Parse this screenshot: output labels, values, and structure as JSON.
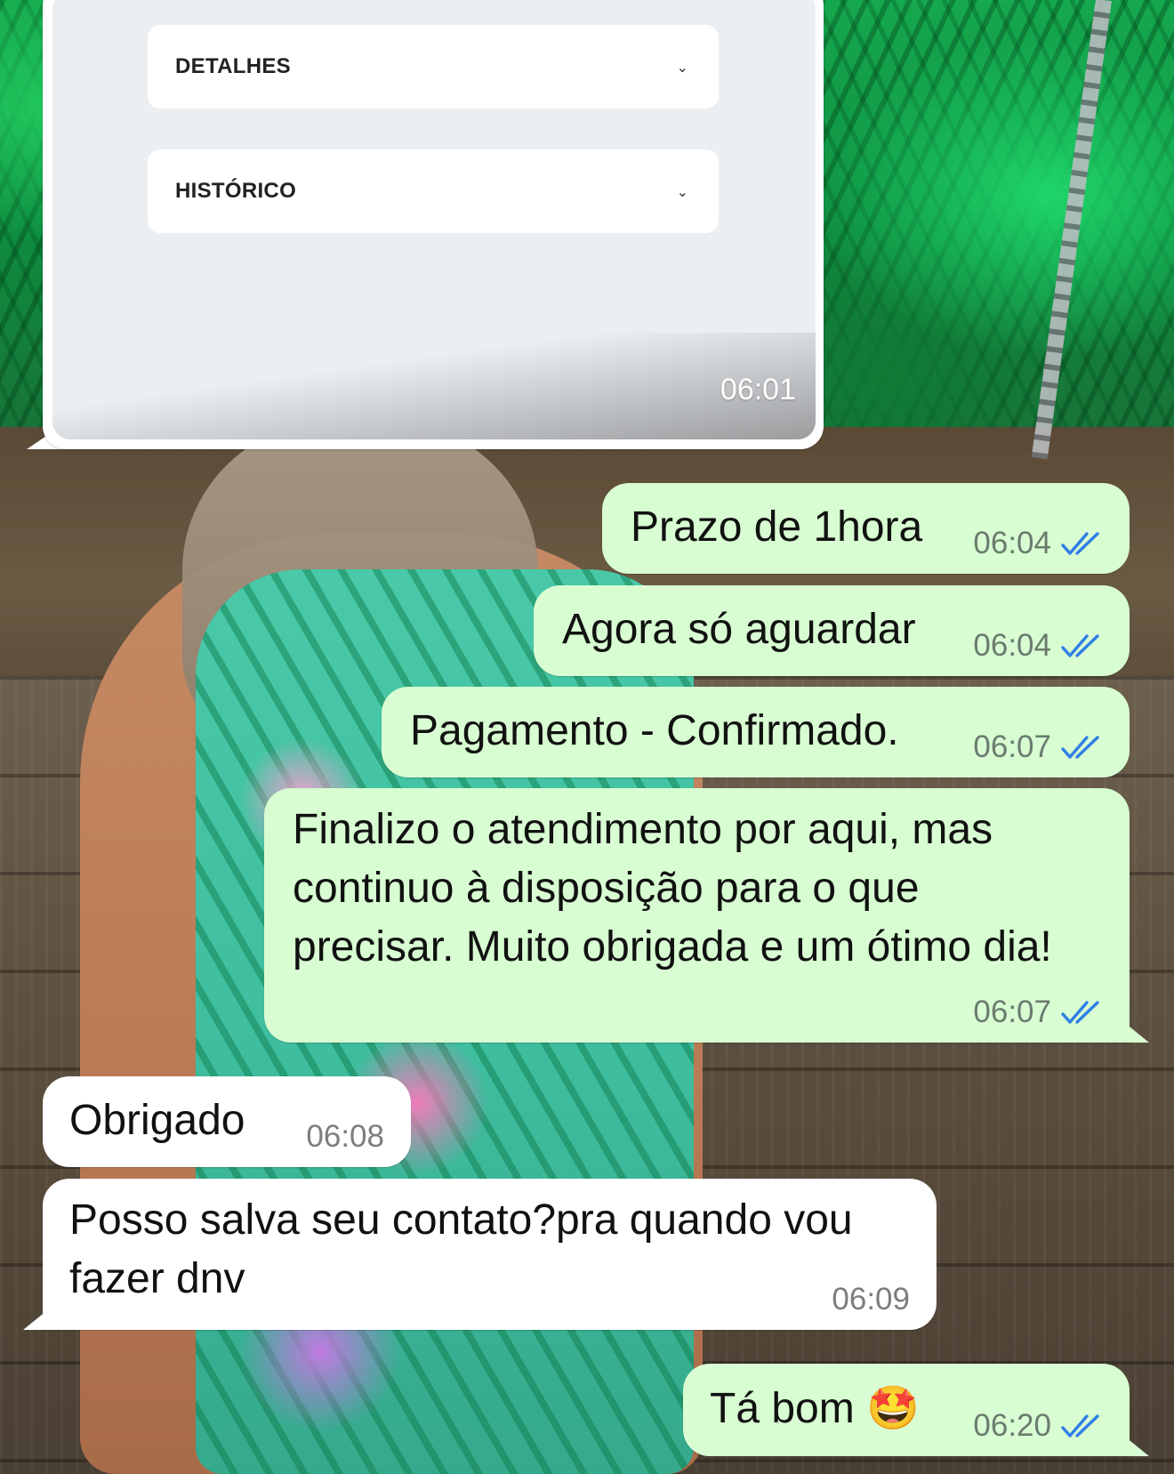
{
  "shared_card": {
    "sections": [
      {
        "label": "DETALHES",
        "icon": "chevron-down-icon"
      },
      {
        "label": "HISTÓRICO",
        "icon": "chevron-down-icon"
      }
    ],
    "time": "06:01"
  },
  "messages": [
    {
      "direction": "outgoing",
      "text": "Prazo de 1hora",
      "time": "06:04",
      "status": "read"
    },
    {
      "direction": "outgoing",
      "text": "Agora só aguardar",
      "time": "06:04",
      "status": "read"
    },
    {
      "direction": "outgoing",
      "text": "Pagamento - Confirmado.",
      "time": "06:07",
      "status": "read"
    },
    {
      "direction": "outgoing",
      "lines": [
        "Finalizo o atendimento por aqui, mas",
        "continuo à disposição para o que",
        "precisar. Muito obrigada e um ótimo dia!"
      ],
      "time": "06:07",
      "status": "read"
    },
    {
      "direction": "incoming",
      "text": "Obrigado",
      "time": "06:08"
    },
    {
      "direction": "incoming",
      "lines": [
        "Posso salva seu contato?pra quando vou",
        "fazer dnv"
      ],
      "time": "06:09"
    },
    {
      "direction": "outgoing",
      "text": "Tá bom 🤩",
      "time": "06:20",
      "status": "read"
    }
  ],
  "colors": {
    "outgoing_bubble": "#d8fdd2",
    "incoming_bubble": "#ffffff",
    "read_ticks": "#2f7ee6"
  }
}
